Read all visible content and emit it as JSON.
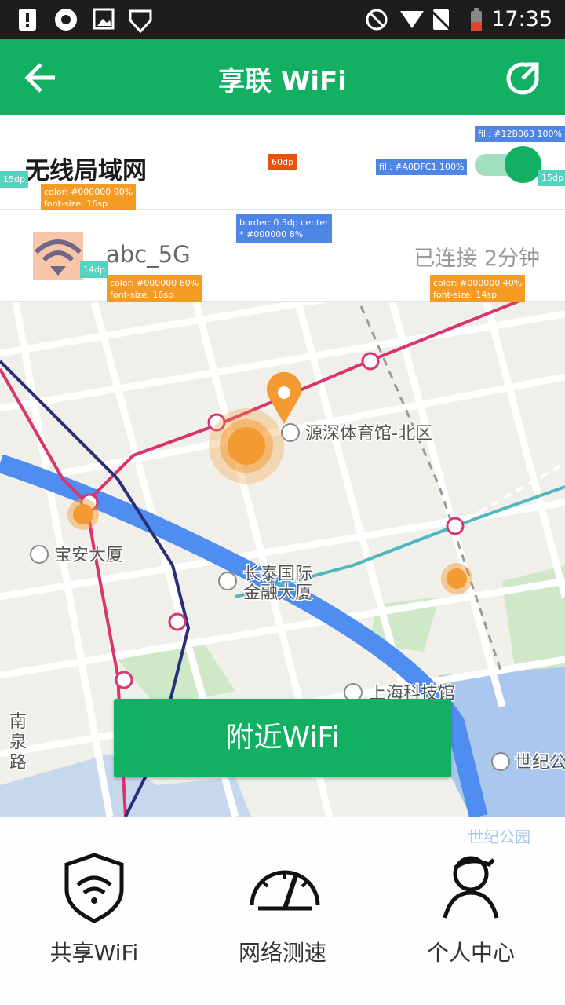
{
  "status_bar": {
    "time": "17:35"
  },
  "app_bar": {
    "title": "享联 WiFi"
  },
  "wifi_toggle": {
    "label": "无线局域网",
    "enabled": true
  },
  "current_network": {
    "ssid": "abc_5G",
    "status": "已连接 2分钟"
  },
  "spec_labels": {
    "left_margin": "15dp",
    "right_margin": "15dp",
    "row_height": "60dp",
    "icon_gap": "14dp",
    "wlan_text": "color: #000000 90%\nfont-size: 16sp",
    "border": "border: 0.5dp center\n* #000000 8%",
    "ssid_text": "color: #000000 60%\nfont-size: 16sp",
    "status_text": "color: #000000 40%\nfont-size: 14sp",
    "thumb_fill": "fill: #12B063 100%",
    "track_fill": "fill: #A0DFC1 100%"
  },
  "map": {
    "pois": [
      "源深体育馆-北区",
      "宝安大厦",
      "长泰国际",
      "金融大厦",
      "上海科技馆",
      "世纪公",
      "世纪公园",
      "南",
      "泉",
      "路"
    ]
  },
  "nearby_button": {
    "label": "附近WiFi"
  },
  "bottom_nav": [
    {
      "label": "共享WiFi",
      "icon": "shield-wifi-icon"
    },
    {
      "label": "网络测速",
      "icon": "speedometer-icon"
    },
    {
      "label": "个人中心",
      "icon": "person-icon"
    }
  ],
  "colors": {
    "primary": "#12B063",
    "track": "#A0DFC1",
    "marker": "#F39A33",
    "road": "#4F8EF0",
    "metro_pink": "#D9346E",
    "metro_navy": "#2B2C7A",
    "metro_teal": "#4FB7C1"
  }
}
